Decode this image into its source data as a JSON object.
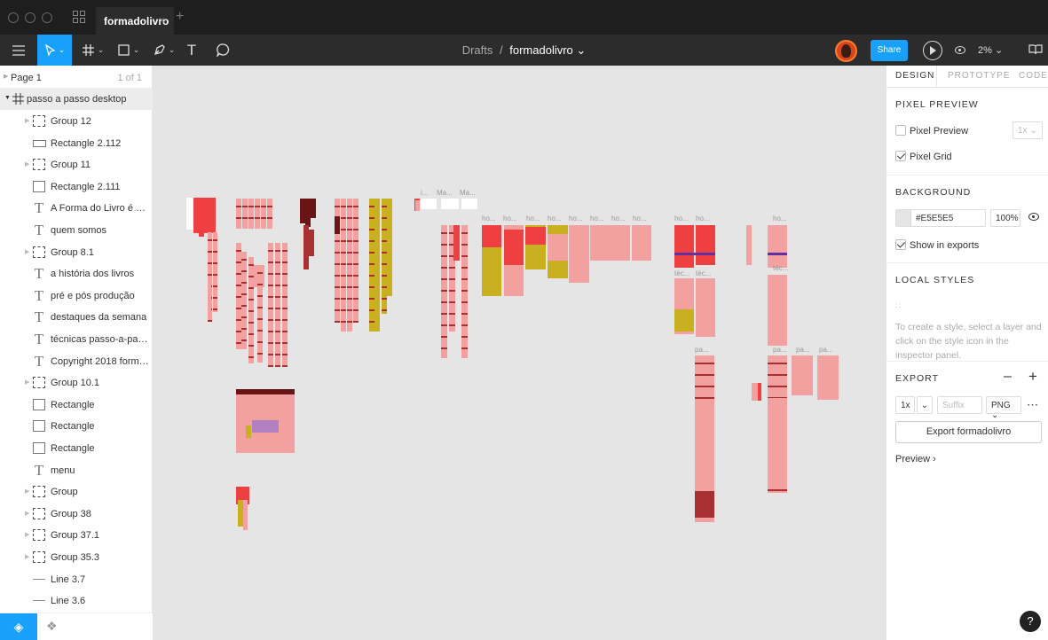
{
  "tab": {
    "title": "formadolivro",
    "close": "×",
    "new": "+"
  },
  "breadcrumb": {
    "project": "Drafts",
    "separator": "/",
    "file": "formadolivro ⌄"
  },
  "toolbar": {
    "share": "Share",
    "zoom": "2% ⌄",
    "text_tool": "T"
  },
  "left_panel": {
    "page_name": "Page 1",
    "page_count": "1 of 1",
    "frame_name": "passo a passo desktop",
    "layers": [
      {
        "name": "Group 12",
        "icon": "group-icon",
        "expandable": true
      },
      {
        "name": "Rectangle 2.112",
        "icon": "rectangle-icon",
        "expandable": false
      },
      {
        "name": "Group 11",
        "icon": "group-icon",
        "expandable": true
      },
      {
        "name": "Rectangle 2.111",
        "icon": "rectangle-icon",
        "expandable": false
      },
      {
        "name": "A Forma do Livro é uma p...",
        "icon": "text-icon",
        "expandable": false
      },
      {
        "name": "quem somos",
        "icon": "text-icon",
        "expandable": false
      },
      {
        "name": "Group 8.1",
        "icon": "group-icon",
        "expandable": true
      },
      {
        "name": "a história dos livros",
        "icon": "text-icon",
        "expandable": false
      },
      {
        "name": "pré e pós produção",
        "icon": "text-icon",
        "expandable": false
      },
      {
        "name": "destaques da semana",
        "icon": "text-icon",
        "expandable": false
      },
      {
        "name": "técnicas passo-a-passo",
        "icon": "text-icon",
        "expandable": false
      },
      {
        "name": "Copyright 2018 forma do ...",
        "icon": "text-icon",
        "expandable": false
      },
      {
        "name": "Group 10.1",
        "icon": "group-icon",
        "expandable": true
      },
      {
        "name": "Rectangle",
        "icon": "rectangle-icon",
        "expandable": false
      },
      {
        "name": "Rectangle",
        "icon": "rectangle-icon",
        "expandable": false
      },
      {
        "name": "Rectangle",
        "icon": "rectangle-icon",
        "expandable": false
      },
      {
        "name": "menu",
        "icon": "text-icon",
        "expandable": false
      },
      {
        "name": "Group",
        "icon": "group-icon",
        "expandable": true
      },
      {
        "name": "Group 38",
        "icon": "group-icon",
        "expandable": true
      },
      {
        "name": "Group 37.1",
        "icon": "group-icon",
        "expandable": true
      },
      {
        "name": "Group 35.3",
        "icon": "group-icon",
        "expandable": true
      },
      {
        "name": "Line 3.7",
        "icon": "line-icon",
        "expandable": false
      },
      {
        "name": "Line 3.6",
        "icon": "line-icon",
        "expandable": false
      }
    ]
  },
  "canvas": {
    "background": "#E5E5E5",
    "frame_labels": [
      "i...",
      "Ma...",
      "Ma...",
      "ho...",
      "ho...",
      "ho...",
      "ho...",
      "ho...",
      "ho...",
      "ho...",
      "ho...",
      "ho...",
      "ho...",
      "ho...",
      "téc...",
      "téc...",
      "téc...",
      "pa...",
      "pa...",
      "pa...",
      "pa..."
    ]
  },
  "right_panel": {
    "tabs": [
      "DESIGN",
      "PROTOTYPE",
      "CODE"
    ],
    "pixel_preview": {
      "heading": "PIXEL PREVIEW",
      "preview_label": "Pixel Preview",
      "preview_checked": false,
      "scale": "1x ⌄",
      "grid_label": "Pixel Grid",
      "grid_checked": true
    },
    "background": {
      "heading": "BACKGROUND",
      "color": "#E5E5E5",
      "hex_label": "#E5E5E5",
      "opacity": "100%",
      "exports_label": "Show in exports",
      "exports_checked": true
    },
    "local_styles": {
      "heading": "LOCAL STYLES",
      "hint": "To create a style, select a layer and click on the style icon in the inspector panel."
    },
    "export": {
      "heading": "EXPORT",
      "minus": "–",
      "plus": "+",
      "scale": "1x",
      "suffix_placeholder": "Suffix",
      "format": "PNG ⌄",
      "more": "⋯",
      "button": "Export formadolivro",
      "preview": "Preview ›"
    }
  },
  "help": "?"
}
